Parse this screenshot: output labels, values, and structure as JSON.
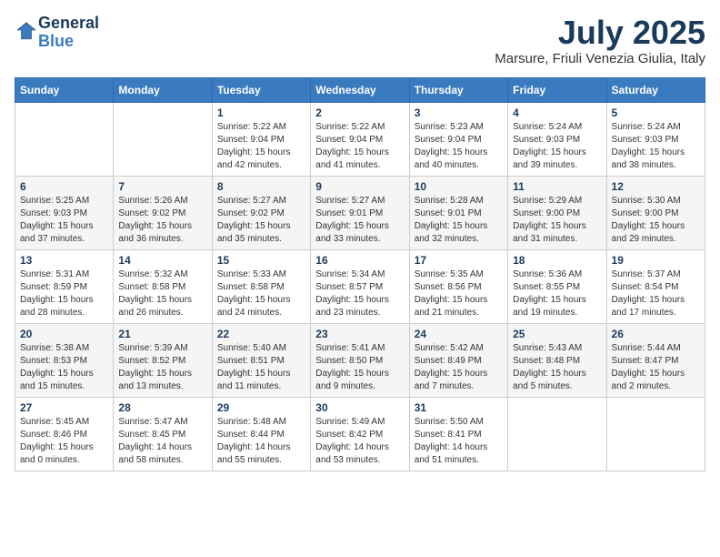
{
  "logo": {
    "line1": "General",
    "line2": "Blue"
  },
  "title": "July 2025",
  "location": "Marsure, Friuli Venezia Giulia, Italy",
  "weekdays": [
    "Sunday",
    "Monday",
    "Tuesday",
    "Wednesday",
    "Thursday",
    "Friday",
    "Saturday"
  ],
  "weeks": [
    [
      null,
      null,
      {
        "day": "1",
        "sunrise": "5:22 AM",
        "sunset": "9:04 PM",
        "daylight": "15 hours and 42 minutes."
      },
      {
        "day": "2",
        "sunrise": "5:22 AM",
        "sunset": "9:04 PM",
        "daylight": "15 hours and 41 minutes."
      },
      {
        "day": "3",
        "sunrise": "5:23 AM",
        "sunset": "9:04 PM",
        "daylight": "15 hours and 40 minutes."
      },
      {
        "day": "4",
        "sunrise": "5:24 AM",
        "sunset": "9:03 PM",
        "daylight": "15 hours and 39 minutes."
      },
      {
        "day": "5",
        "sunrise": "5:24 AM",
        "sunset": "9:03 PM",
        "daylight": "15 hours and 38 minutes."
      }
    ],
    [
      {
        "day": "6",
        "sunrise": "5:25 AM",
        "sunset": "9:03 PM",
        "daylight": "15 hours and 37 minutes."
      },
      {
        "day": "7",
        "sunrise": "5:26 AM",
        "sunset": "9:02 PM",
        "daylight": "15 hours and 36 minutes."
      },
      {
        "day": "8",
        "sunrise": "5:27 AM",
        "sunset": "9:02 PM",
        "daylight": "15 hours and 35 minutes."
      },
      {
        "day": "9",
        "sunrise": "5:27 AM",
        "sunset": "9:01 PM",
        "daylight": "15 hours and 33 minutes."
      },
      {
        "day": "10",
        "sunrise": "5:28 AM",
        "sunset": "9:01 PM",
        "daylight": "15 hours and 32 minutes."
      },
      {
        "day": "11",
        "sunrise": "5:29 AM",
        "sunset": "9:00 PM",
        "daylight": "15 hours and 31 minutes."
      },
      {
        "day": "12",
        "sunrise": "5:30 AM",
        "sunset": "9:00 PM",
        "daylight": "15 hours and 29 minutes."
      }
    ],
    [
      {
        "day": "13",
        "sunrise": "5:31 AM",
        "sunset": "8:59 PM",
        "daylight": "15 hours and 28 minutes."
      },
      {
        "day": "14",
        "sunrise": "5:32 AM",
        "sunset": "8:58 PM",
        "daylight": "15 hours and 26 minutes."
      },
      {
        "day": "15",
        "sunrise": "5:33 AM",
        "sunset": "8:58 PM",
        "daylight": "15 hours and 24 minutes."
      },
      {
        "day": "16",
        "sunrise": "5:34 AM",
        "sunset": "8:57 PM",
        "daylight": "15 hours and 23 minutes."
      },
      {
        "day": "17",
        "sunrise": "5:35 AM",
        "sunset": "8:56 PM",
        "daylight": "15 hours and 21 minutes."
      },
      {
        "day": "18",
        "sunrise": "5:36 AM",
        "sunset": "8:55 PM",
        "daylight": "15 hours and 19 minutes."
      },
      {
        "day": "19",
        "sunrise": "5:37 AM",
        "sunset": "8:54 PM",
        "daylight": "15 hours and 17 minutes."
      }
    ],
    [
      {
        "day": "20",
        "sunrise": "5:38 AM",
        "sunset": "8:53 PM",
        "daylight": "15 hours and 15 minutes."
      },
      {
        "day": "21",
        "sunrise": "5:39 AM",
        "sunset": "8:52 PM",
        "daylight": "15 hours and 13 minutes."
      },
      {
        "day": "22",
        "sunrise": "5:40 AM",
        "sunset": "8:51 PM",
        "daylight": "15 hours and 11 minutes."
      },
      {
        "day": "23",
        "sunrise": "5:41 AM",
        "sunset": "8:50 PM",
        "daylight": "15 hours and 9 minutes."
      },
      {
        "day": "24",
        "sunrise": "5:42 AM",
        "sunset": "8:49 PM",
        "daylight": "15 hours and 7 minutes."
      },
      {
        "day": "25",
        "sunrise": "5:43 AM",
        "sunset": "8:48 PM",
        "daylight": "15 hours and 5 minutes."
      },
      {
        "day": "26",
        "sunrise": "5:44 AM",
        "sunset": "8:47 PM",
        "daylight": "15 hours and 2 minutes."
      }
    ],
    [
      {
        "day": "27",
        "sunrise": "5:45 AM",
        "sunset": "8:46 PM",
        "daylight": "15 hours and 0 minutes."
      },
      {
        "day": "28",
        "sunrise": "5:47 AM",
        "sunset": "8:45 PM",
        "daylight": "14 hours and 58 minutes."
      },
      {
        "day": "29",
        "sunrise": "5:48 AM",
        "sunset": "8:44 PM",
        "daylight": "14 hours and 55 minutes."
      },
      {
        "day": "30",
        "sunrise": "5:49 AM",
        "sunset": "8:42 PM",
        "daylight": "14 hours and 53 minutes."
      },
      {
        "day": "31",
        "sunrise": "5:50 AM",
        "sunset": "8:41 PM",
        "daylight": "14 hours and 51 minutes."
      },
      null,
      null
    ]
  ],
  "labels": {
    "sunrise": "Sunrise:",
    "sunset": "Sunset:",
    "daylight": "Daylight:"
  }
}
